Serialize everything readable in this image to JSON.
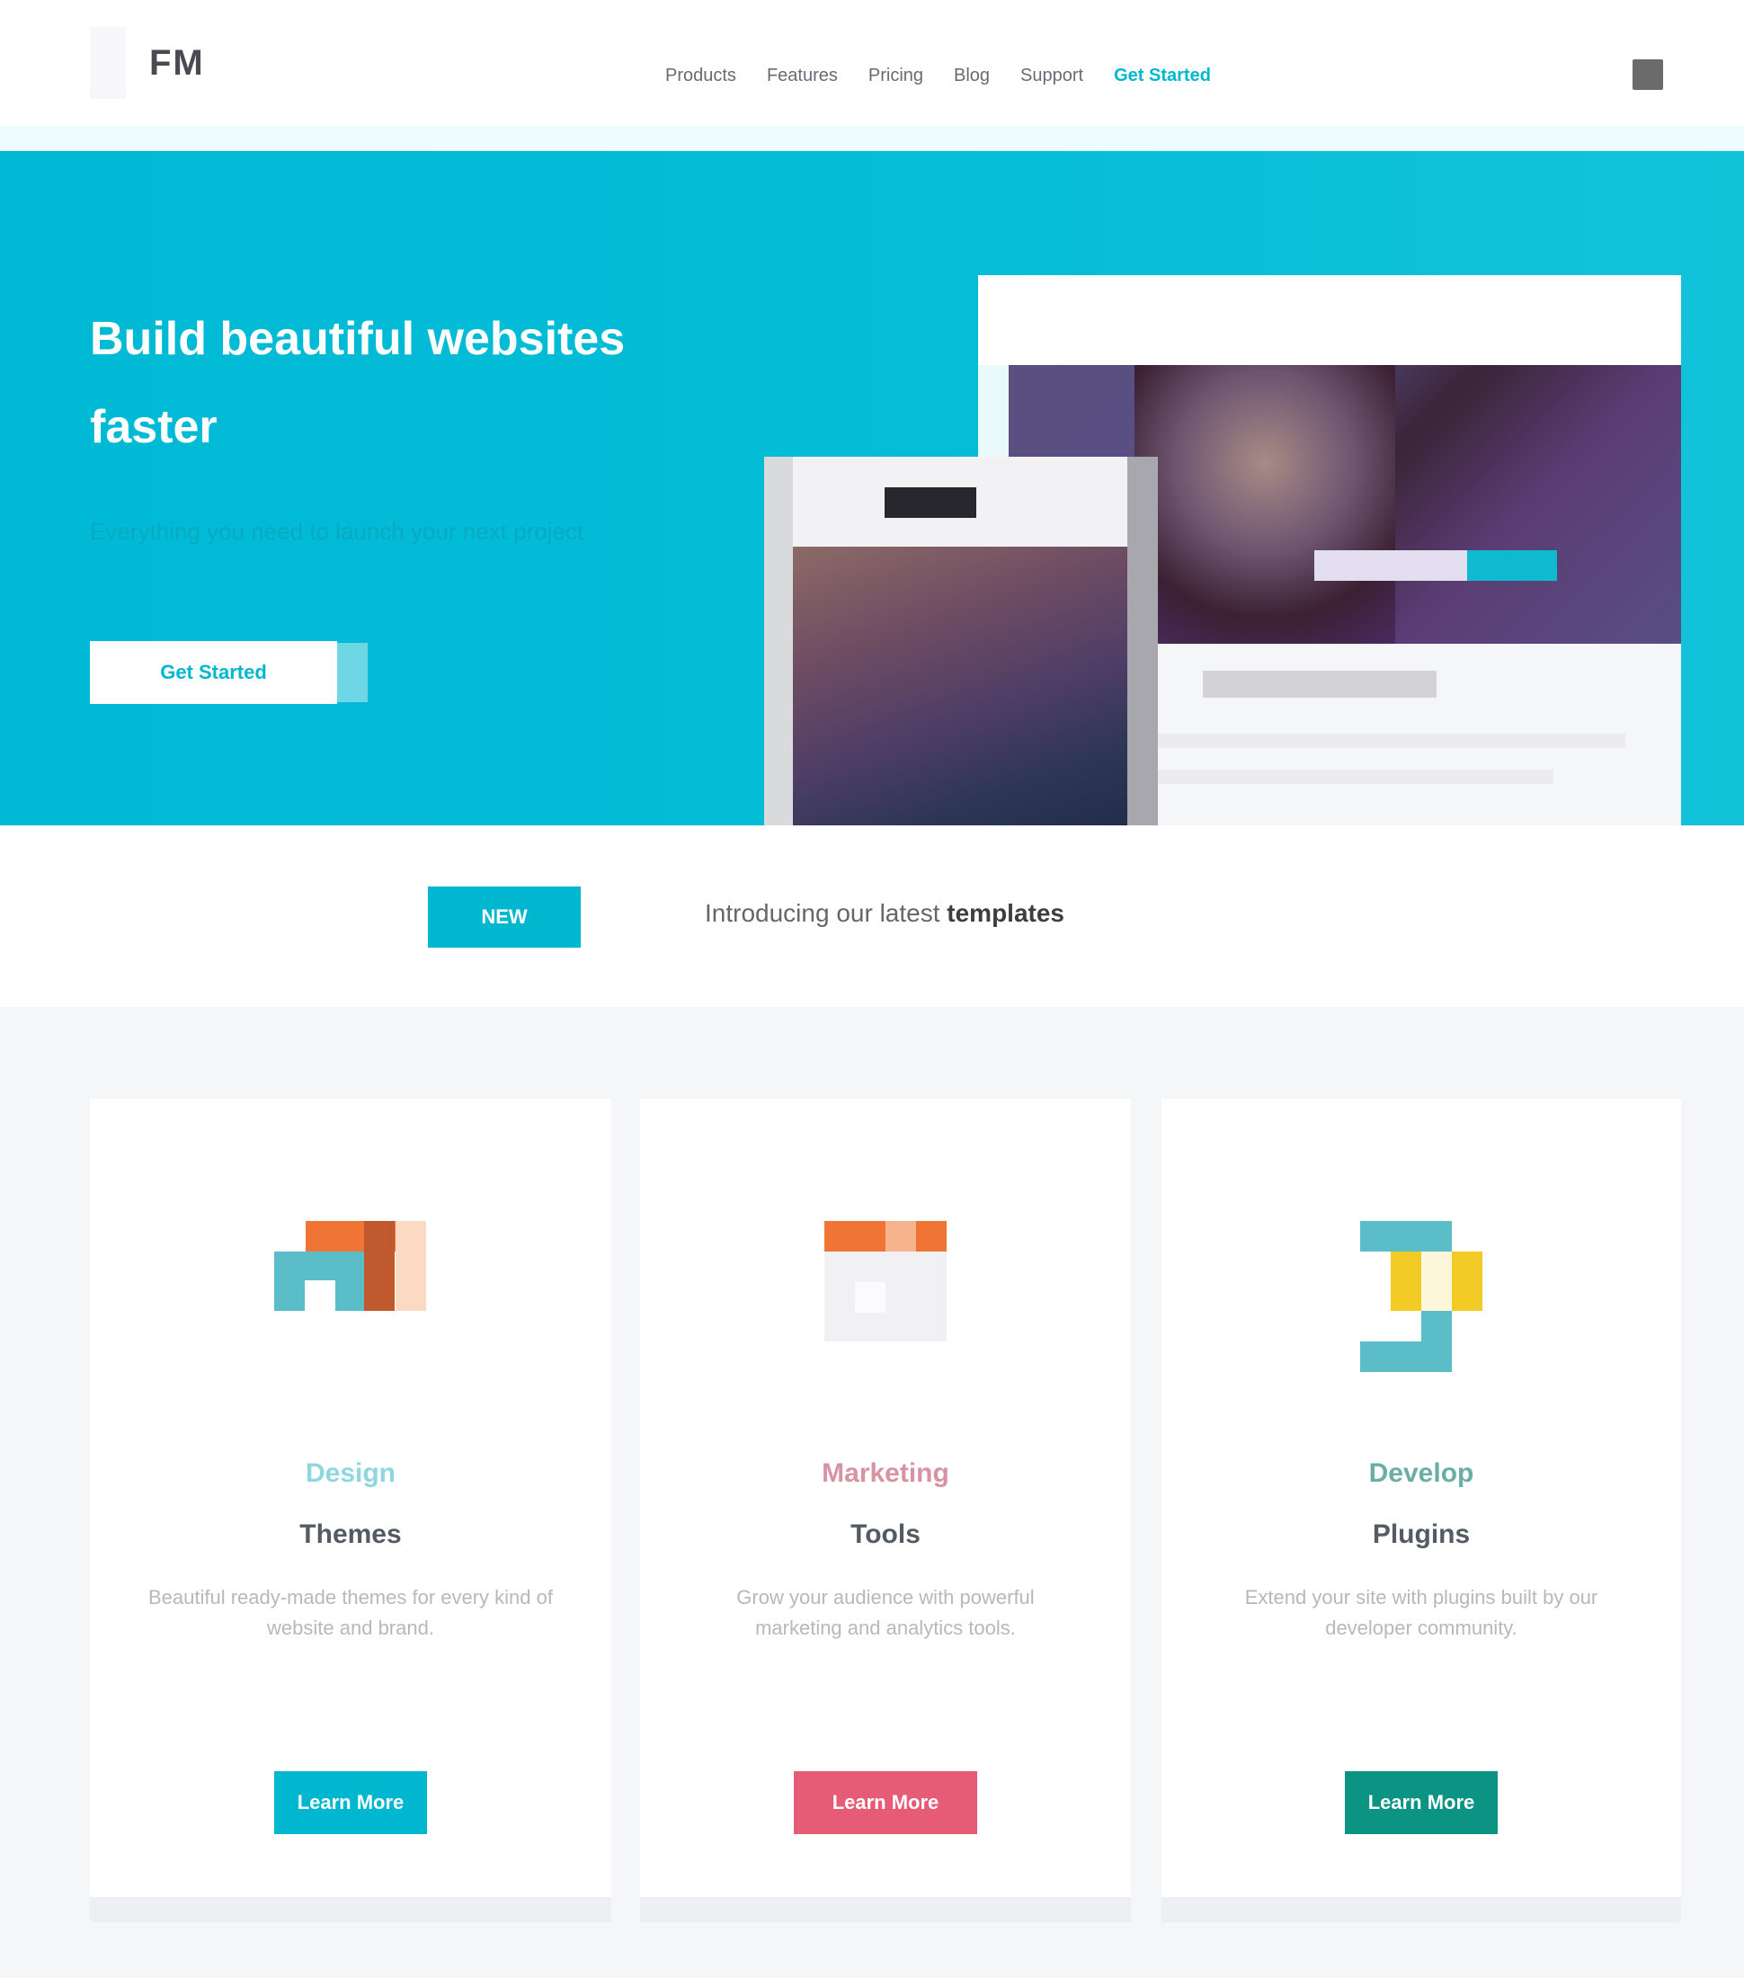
{
  "header": {
    "logo_text": "FM",
    "nav": [
      {
        "label": "Products",
        "accent": false
      },
      {
        "label": "Features",
        "accent": false
      },
      {
        "label": "Pricing",
        "accent": false
      },
      {
        "label": "Blog",
        "accent": false
      },
      {
        "label": "Support",
        "accent": false
      },
      {
        "label": "Get Started",
        "accent": true
      }
    ]
  },
  "hero": {
    "title": "Build beautiful websites faster",
    "subtitle": "Everything you need to launch your next project",
    "cta_label": "Get Started"
  },
  "strip": {
    "badge": "NEW",
    "text": "Introducing our latest",
    "text_strong": "templates"
  },
  "cards": [
    {
      "title": "Design",
      "subtitle": "Themes",
      "description": "Beautiful ready-made themes for every kind of website and brand.",
      "button": "Learn More",
      "accent": "#00b7d0",
      "title_color": "#8ed7e1",
      "icon": "layout-icon"
    },
    {
      "title": "Marketing",
      "subtitle": "Tools",
      "description": "Grow your audience with powerful marketing and analytics tools.",
      "button": "Learn More",
      "accent": "#e65b76",
      "title_color": "#d893a3",
      "icon": "browser-icon"
    },
    {
      "title": "Develop",
      "subtitle": "Plugins",
      "description": "Extend your site with plugins built by our developer community.",
      "button": "Learn More",
      "accent": "#0b9484",
      "title_color": "#6aaea5",
      "icon": "code-icon"
    }
  ]
}
